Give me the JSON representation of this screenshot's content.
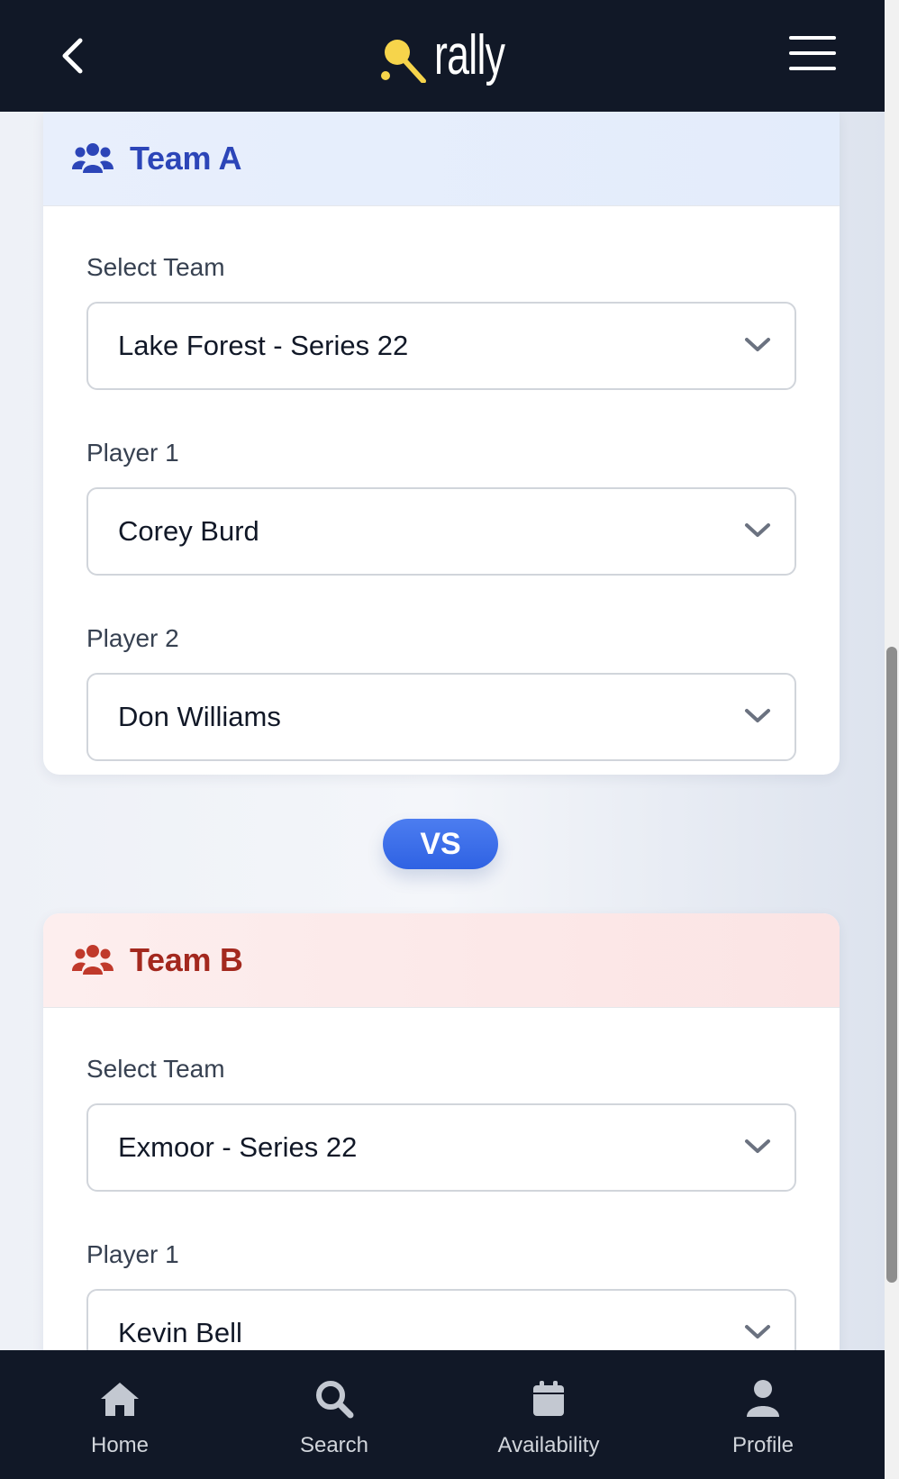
{
  "header": {
    "logo_text": "rally",
    "logo_accent": "#f6d44b"
  },
  "team_a": {
    "title": "Team A",
    "accent": "#2c45b8",
    "fields": [
      {
        "label": "Select Team",
        "value": "Lake Forest - Series 22"
      },
      {
        "label": "Player 1",
        "value": "Corey Burd"
      },
      {
        "label": "Player 2",
        "value": "Don Williams"
      }
    ]
  },
  "vs_label": "VS",
  "team_b": {
    "title": "Team B",
    "accent": "#a3281e",
    "fields": [
      {
        "label": "Select Team",
        "value": "Exmoor - Series 22"
      },
      {
        "label": "Player 1",
        "value": "Kevin Bell"
      }
    ]
  },
  "bottom_nav": [
    {
      "label": "Home",
      "icon": "home-icon"
    },
    {
      "label": "Search",
      "icon": "search-icon"
    },
    {
      "label": "Availability",
      "icon": "calendar-icon"
    },
    {
      "label": "Profile",
      "icon": "user-icon"
    }
  ]
}
